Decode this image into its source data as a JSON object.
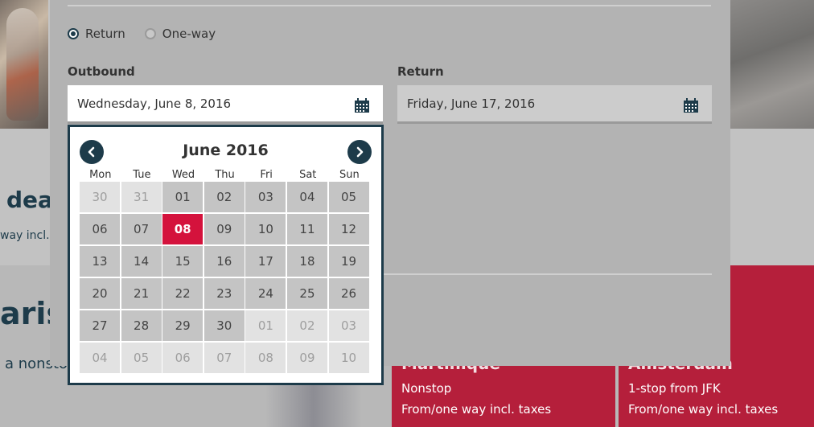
{
  "background": {
    "deal_heading": "dea",
    "deal_sub": "way incl.",
    "city_heading": "aris",
    "city_sub": "a nonsto",
    "cards": [
      {
        "title": "Martinique",
        "line1": "Nonstop",
        "line2": "From/one way incl. taxes"
      },
      {
        "title": "Amsterdam",
        "line1": "1-stop from JFK",
        "line2": "From/one way incl. taxes"
      }
    ]
  },
  "trip_type": {
    "options": [
      {
        "label": "Return",
        "checked": true
      },
      {
        "label": "One-way",
        "checked": false
      }
    ]
  },
  "outbound": {
    "label": "Outbound",
    "value": "Wednesday, June 8, 2016",
    "icon": "calendar-icon"
  },
  "return": {
    "label": "Return",
    "value": "Friday, June 17, 2016",
    "icon": "calendar-icon"
  },
  "datepicker": {
    "month_title": "June 2016",
    "prev_icon": "chevron-left-icon",
    "next_icon": "chevron-right-icon",
    "weekdays": [
      "Mon",
      "Tue",
      "Wed",
      "Thu",
      "Fri",
      "Sat",
      "Sun"
    ],
    "days": [
      {
        "d": "30",
        "other": true
      },
      {
        "d": "31",
        "other": true
      },
      {
        "d": "01"
      },
      {
        "d": "02"
      },
      {
        "d": "03"
      },
      {
        "d": "04"
      },
      {
        "d": "05"
      },
      {
        "d": "06"
      },
      {
        "d": "07"
      },
      {
        "d": "08",
        "selected": true
      },
      {
        "d": "09"
      },
      {
        "d": "10"
      },
      {
        "d": "11"
      },
      {
        "d": "12"
      },
      {
        "d": "13"
      },
      {
        "d": "14"
      },
      {
        "d": "15"
      },
      {
        "d": "16"
      },
      {
        "d": "17"
      },
      {
        "d": "18"
      },
      {
        "d": "19"
      },
      {
        "d": "20"
      },
      {
        "d": "21"
      },
      {
        "d": "22"
      },
      {
        "d": "23"
      },
      {
        "d": "24"
      },
      {
        "d": "25"
      },
      {
        "d": "26"
      },
      {
        "d": "27"
      },
      {
        "d": "28"
      },
      {
        "d": "29"
      },
      {
        "d": "30"
      },
      {
        "d": "01",
        "other": true
      },
      {
        "d": "02",
        "other": true
      },
      {
        "d": "03",
        "other": true
      },
      {
        "d": "04",
        "other": true
      },
      {
        "d": "05",
        "other": true
      },
      {
        "d": "06",
        "other": true
      },
      {
        "d": "07",
        "other": true
      },
      {
        "d": "08",
        "other": true
      },
      {
        "d": "09",
        "other": true
      },
      {
        "d": "10",
        "other": true
      }
    ]
  },
  "colors": {
    "accent": "#1d3b4a",
    "selected_day": "#d4123c",
    "card_red": "#b51f3b"
  }
}
